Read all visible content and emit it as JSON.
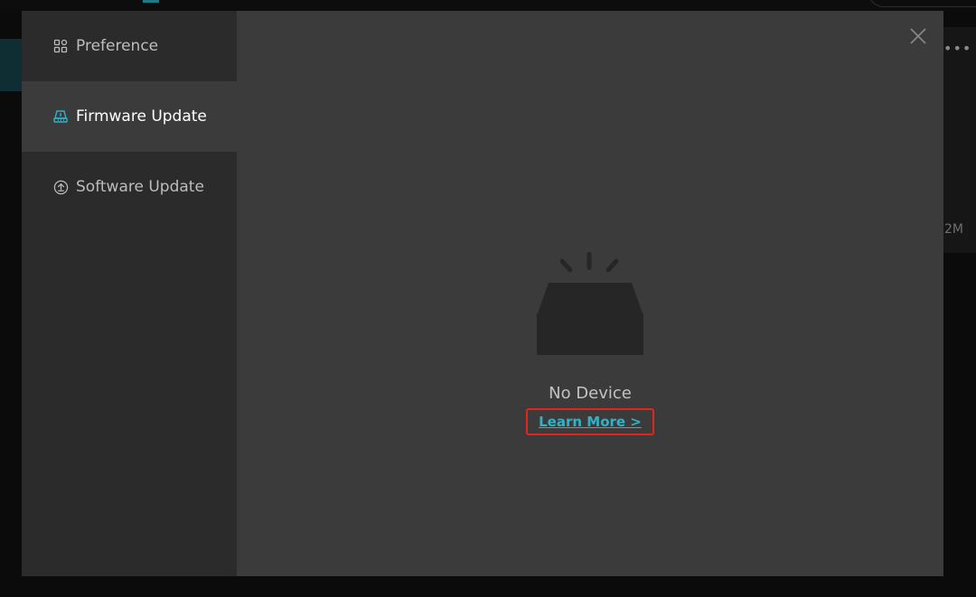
{
  "background": {
    "right_panel_size_text": "2M"
  },
  "sidebar": {
    "items": [
      {
        "label": "Preference",
        "icon": "grid-icon",
        "active": false
      },
      {
        "label": "Firmware Update",
        "icon": "device-icon",
        "active": true
      },
      {
        "label": "Software Update",
        "icon": "software-update-icon",
        "active": false
      }
    ]
  },
  "main": {
    "empty_state": {
      "icon": "empty-inbox-icon",
      "label": "No Device",
      "link_label": "Learn More >"
    }
  },
  "colors": {
    "accent": "#2fb3c9",
    "highlight_border": "#e0261e"
  }
}
